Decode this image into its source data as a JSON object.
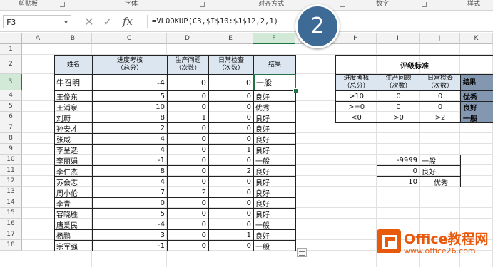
{
  "ribbon": {
    "groups": [
      "剪贴板",
      "字体",
      "对齐方式",
      "数字",
      "样式"
    ]
  },
  "formula_bar": {
    "name_box": "F3",
    "cancel_symbol": "✕",
    "enter_symbol": "✓",
    "fx_label": "fx",
    "formula": "=VLOOKUP(C3,$I$10:$J$12,2,1)"
  },
  "step_badge": "2",
  "columns": [
    "A",
    "B",
    "C",
    "D",
    "E",
    "F",
    "G",
    "H",
    "I",
    "J",
    "K"
  ],
  "rows": [
    "1",
    "2",
    "3",
    "4",
    "5",
    "6",
    "7",
    "8",
    "9",
    "10",
    "11",
    "12",
    "13",
    "14",
    "15",
    "16",
    "17",
    "18"
  ],
  "main_table": {
    "headers": [
      "姓名",
      "进度考核\n（总分）",
      "生产问题\n（次数）",
      "日常检查\n（次数）",
      "结果"
    ],
    "rows": [
      [
        "牛召明",
        "-4",
        "0",
        "0",
        "一般"
      ],
      [
        "王俊东",
        "5",
        "0",
        "0",
        "良好"
      ],
      [
        "王浦泉",
        "10",
        "0",
        "0",
        "优秀"
      ],
      [
        "刘蔚",
        "8",
        "1",
        "0",
        "良好"
      ],
      [
        "孙安才",
        "2",
        "0",
        "0",
        "良好"
      ],
      [
        "张威",
        "4",
        "0",
        "0",
        "良好"
      ],
      [
        "李呈选",
        "4",
        "0",
        "1",
        "良好"
      ],
      [
        "李丽娟",
        "-1",
        "0",
        "0",
        "一般"
      ],
      [
        "李仁杰",
        "8",
        "0",
        "2",
        "良好"
      ],
      [
        "苏会志",
        "4",
        "0",
        "0",
        "良好"
      ],
      [
        "周小伦",
        "7",
        "2",
        "0",
        "良好"
      ],
      [
        "李青",
        "0",
        "0",
        "0",
        "良好"
      ],
      [
        "容晓胜",
        "5",
        "0",
        "0",
        "良好"
      ],
      [
        "唐爱民",
        "-4",
        "0",
        "0",
        "一般"
      ],
      [
        "杨鹏",
        "3",
        "0",
        "1",
        "良好"
      ],
      [
        "宗军强",
        "-1",
        "0",
        "0",
        "一般"
      ]
    ]
  },
  "criteria_table": {
    "title": "评级标准",
    "headers": [
      "进度考核\n（总分）",
      "生产问题\n（次数）",
      "日常检查\n（次数）",
      "结果"
    ],
    "rows": [
      [
        ">10",
        "0",
        "0",
        "优秀"
      ],
      [
        ">=0",
        "0",
        "0",
        "良好"
      ],
      [
        "<0",
        ">0",
        ">2",
        "一般"
      ]
    ]
  },
  "lookup_table": [
    [
      "-9999",
      "一般"
    ],
    [
      "0",
      "良好"
    ],
    [
      "10",
      "优秀"
    ]
  ],
  "watermark": {
    "name": "Office教程网",
    "url": "www.office26.com"
  }
}
